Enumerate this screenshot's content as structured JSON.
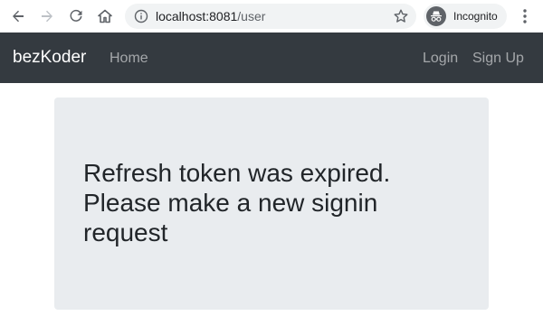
{
  "browser": {
    "url_host": "localhost:8081",
    "url_path": "/user",
    "incognito_label": "Incognito"
  },
  "navbar": {
    "brand": "bezKoder",
    "left_links": [
      "Home"
    ],
    "right_links": [
      "Login",
      "Sign Up"
    ]
  },
  "main": {
    "message": "Refresh token was expired. Please make a new signin request"
  },
  "colors": {
    "navbar_bg": "#343a40",
    "jumbotron_bg": "#e9ecef",
    "chrome_pill_bg": "#f1f3f4"
  }
}
